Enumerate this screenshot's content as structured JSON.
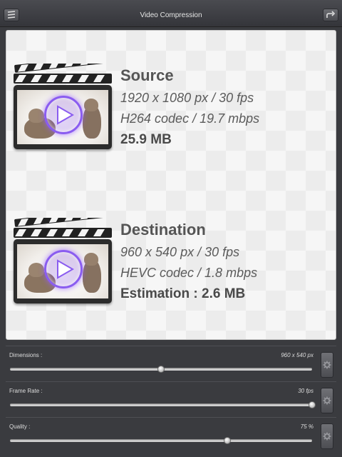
{
  "nav": {
    "title": "Video Compression",
    "left_icon": "menu-icon",
    "right_icon": "share-icon"
  },
  "source": {
    "heading": "Source",
    "resolution": "1920 x 1080 px / 30 fps",
    "codec": "H264 codec / 19.7 mbps",
    "size": "25.9 MB"
  },
  "destination": {
    "heading": "Destination",
    "resolution": "960 x 540 px / 30 fps",
    "codec": "HEVC codec / 1.8 mbps",
    "size": "Estimation : 2.6 MB"
  },
  "controls": [
    {
      "label": "Dimensions :",
      "value": "960 x 540 px",
      "level": 0.5
    },
    {
      "label": "Frame Rate :",
      "value": "30 fps",
      "level": 1.0
    },
    {
      "label": "Quality :",
      "value": "75 %",
      "level": 0.72
    }
  ],
  "colors": {
    "accent_play": "#8a5cf0",
    "background": "#3a3b3f"
  }
}
